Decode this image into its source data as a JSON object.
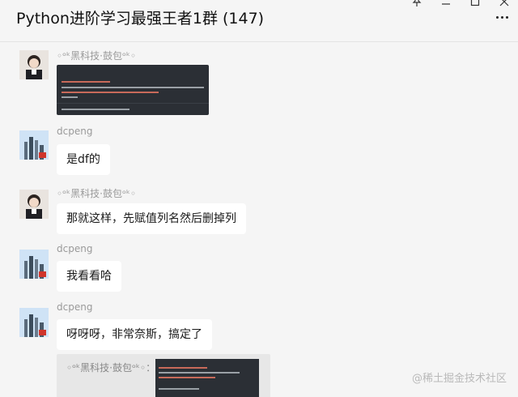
{
  "window": {
    "title": "Python进阶学习最强王者1群 (147)",
    "pin_icon": "pin-icon",
    "minimize_icon": "minimize-icon",
    "maximize_icon": "maximize-icon",
    "close_icon": "close-icon",
    "more_icon": "more-icon"
  },
  "messages": [
    {
      "sender": "◦ᵒᵏ黑科技·鼓包ᵒᵏ◦",
      "type": "image",
      "image_alt": "code screenshot"
    },
    {
      "sender": "dcpeng",
      "type": "text",
      "text": "是df的"
    },
    {
      "sender": "◦ᵒᵏ黑科技·鼓包ᵒᵏ◦",
      "type": "text",
      "text": "那就这样，先赋值列名然后删掉列"
    },
    {
      "sender": "dcpeng",
      "type": "text",
      "text": "我看看哈"
    },
    {
      "sender": "dcpeng",
      "type": "text",
      "text": "呀呀呀，非常奈斯，搞定了"
    }
  ],
  "quote": {
    "text": "◦ᵒᵏ黑科技·鼓包ᵒᵏ◦：",
    "image_alt": "code screenshot"
  },
  "watermark": "@稀土掘金技术社区",
  "colors": {
    "bubble": "#ffffff",
    "background": "#f5f5f5",
    "code_bg": "#2b2f35"
  }
}
